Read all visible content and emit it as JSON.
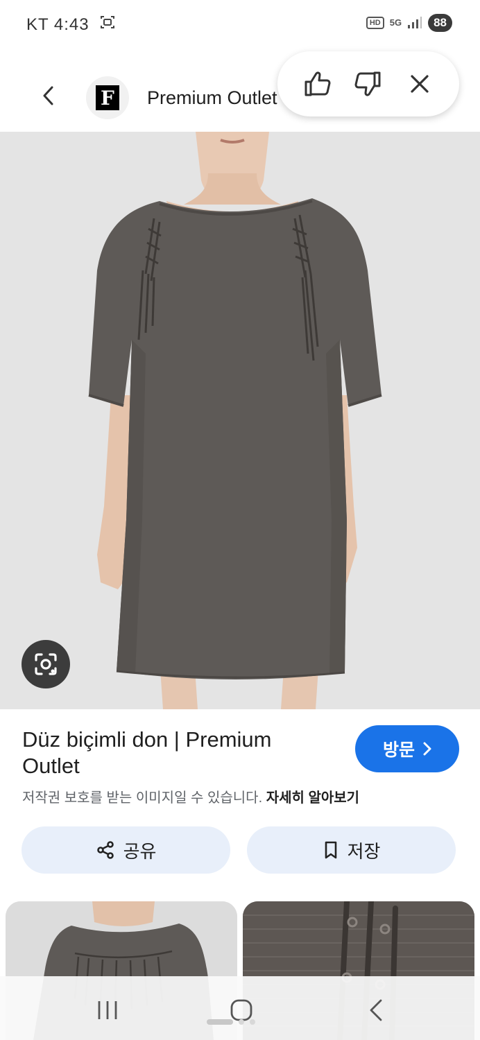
{
  "status_bar": {
    "carrier_time": "KT 4:43",
    "hd_label": "HD",
    "network_label": "5G",
    "battery": "88"
  },
  "header": {
    "site_logo_letter": "F",
    "site_name": "Premium Outlet"
  },
  "feedback": {
    "like": "thumbs-up-icon",
    "dislike": "thumbs-down-icon",
    "close": "close-icon"
  },
  "result": {
    "title": "Düz biçimli don | Premium Outlet",
    "visit_label": "방문",
    "copyright_notice": "저작권 보호를 받는 이미지일 수 있습니다.",
    "learn_more": "자세히 알아보기"
  },
  "actions": {
    "share_label": "공유",
    "save_label": "저장"
  },
  "colors": {
    "accent": "#1a73e8",
    "action_bg": "#e8effa",
    "dress": "#5e5a57"
  }
}
